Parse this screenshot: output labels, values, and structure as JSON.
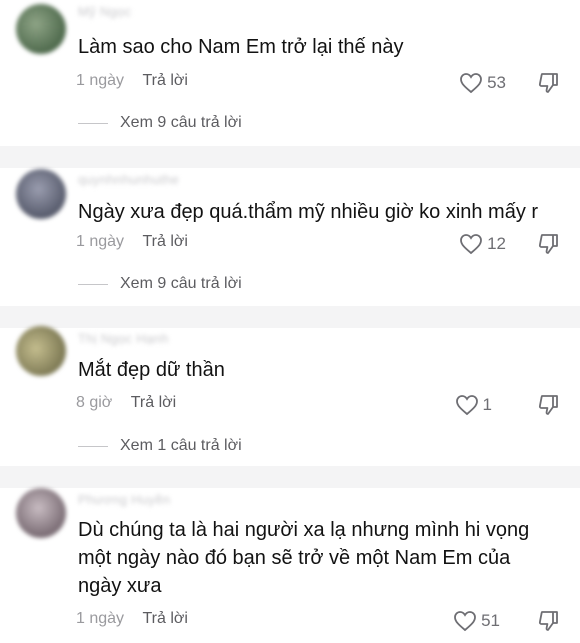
{
  "comments": [
    {
      "username": "Mỹ Ngọc",
      "avatar_color": "#6f8a6a",
      "text": "Làm sao cho Nam Em trở lại thế này",
      "time": "1 ngày",
      "reply": "Trả lời",
      "likes": "53",
      "view_replies": "Xem 9 câu trả lời"
    },
    {
      "username": "quynhnhunhuthe",
      "avatar_color": "#7b7f90",
      "text": "Ngày xưa đẹp quá.thẩm mỹ nhiều giờ ko xinh mấy r",
      "time": "1 ngày",
      "reply": "Trả lời",
      "likes": "12",
      "view_replies": "Xem 9 câu trả lời"
    },
    {
      "username": "Thị Ngọc Hạnh",
      "avatar_color": "#a8a27a",
      "text": "Mắt đẹp dữ thần",
      "time": "8 giờ",
      "reply": "Trả lời",
      "likes": "1",
      "view_replies": "Xem 1 câu trả lời"
    },
    {
      "username": "Phương Huyền",
      "avatar_color": "#9b8f95",
      "text": "Dù chúng ta là hai người xa lạ nhưng mình hi vọng một ngày nào đó bạn sẽ trở về một Nam Em của ngày xưa",
      "time": "1 ngày",
      "reply": "Trả lời",
      "likes": "51"
    }
  ],
  "icons": {
    "like": "heart-outline-icon",
    "dislike": "thumbs-down-icon"
  }
}
